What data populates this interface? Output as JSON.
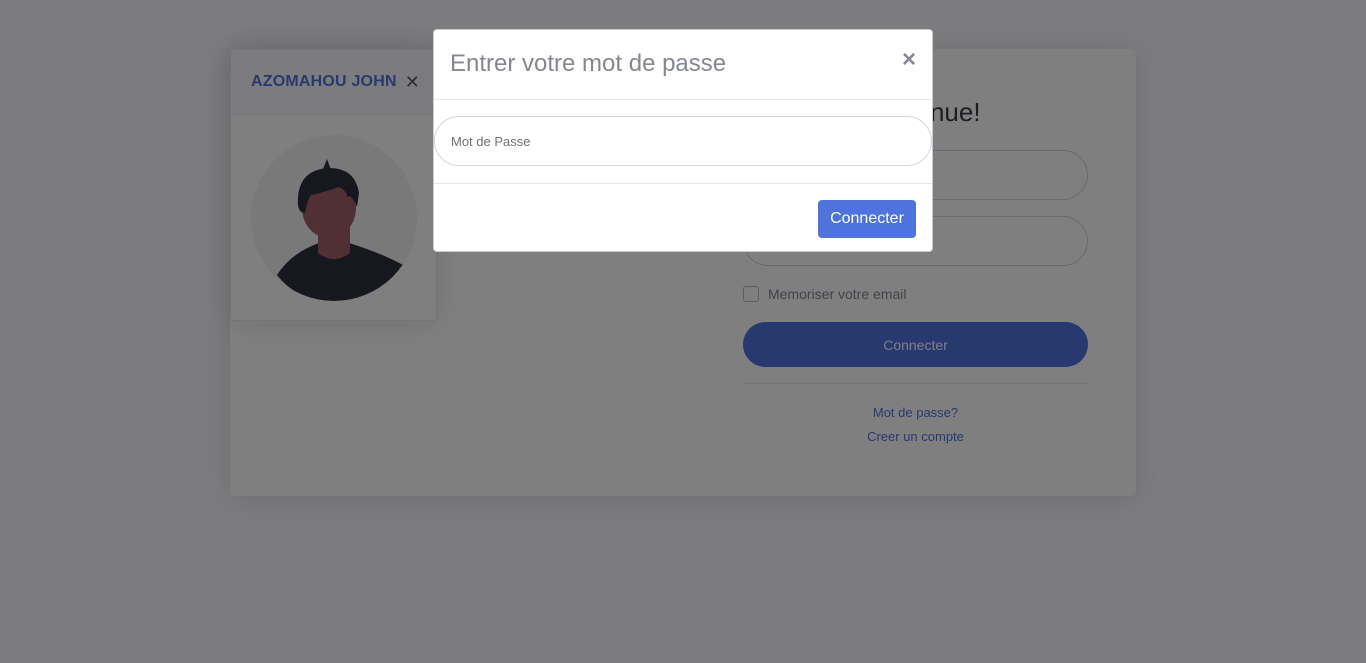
{
  "background_page": {
    "profile": {
      "name": "AZOMAHOU JOHN",
      "close_symbol": "✕",
      "close_icon": "close-icon",
      "avatar_icon": "user-avatar-icon"
    },
    "login": {
      "title_visible_fragment": "nue!",
      "remember_label": "Memoriser votre email",
      "connect_label": "Connecter",
      "forgot_password_link": "Mot de passe?",
      "create_account_link": "Creer un compte"
    }
  },
  "modal": {
    "title": "Entrer votre mot de passe",
    "close_symbol": "×",
    "close_icon": "close-icon",
    "password_placeholder": "Mot de Passe",
    "password_value": "",
    "connect_label": "Connecter"
  },
  "colors": {
    "primary": "#4e73df",
    "text_muted": "#858796",
    "backdrop": "rgba(0,0,0,0.5)"
  }
}
